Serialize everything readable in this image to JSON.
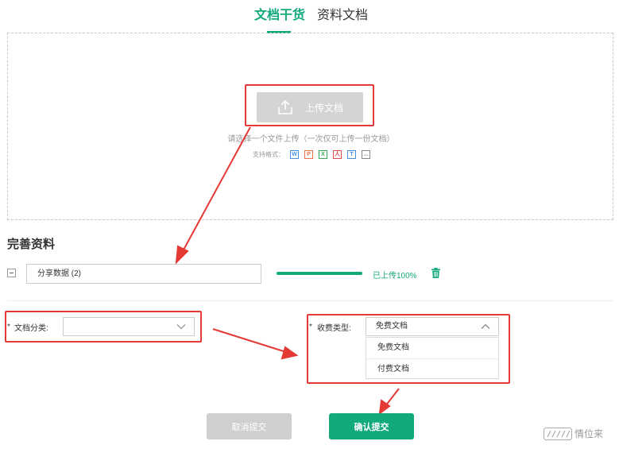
{
  "tabs": [
    {
      "label": "文档干货",
      "active": true
    },
    {
      "label": "资料文档",
      "active": false
    }
  ],
  "upload": {
    "button_label": "上传文档",
    "hint": "请选择一个文件上传（一次仅可上传一份文档）",
    "formats_label": "支持格式：",
    "formats": [
      {
        "letter": "W",
        "color": "#4a90e2"
      },
      {
        "letter": "P",
        "color": "#e8734a"
      },
      {
        "letter": "X",
        "color": "#3aa757"
      },
      {
        "letter": "人",
        "color": "#e04b4b"
      },
      {
        "letter": "T",
        "color": "#4a90e2"
      },
      {
        "letter": "…",
        "color": "#888888"
      }
    ]
  },
  "section": {
    "title": "完善资料"
  },
  "file": {
    "name": "分享数据 (2)",
    "progress": 100,
    "status": "已上传100%"
  },
  "category": {
    "required_mark": "*",
    "label": "文档分类:",
    "value": ""
  },
  "fee": {
    "required_mark": "*",
    "label": "收费类型:",
    "value": "免费文档",
    "options": [
      "免费文档",
      "付费文档"
    ]
  },
  "actions": {
    "cancel_label": "取消提交",
    "confirm_label": "确认提交"
  },
  "watermark": {
    "text": "情位来"
  },
  "colors": {
    "accent": "#12a97d",
    "annotation": "#e53935"
  }
}
